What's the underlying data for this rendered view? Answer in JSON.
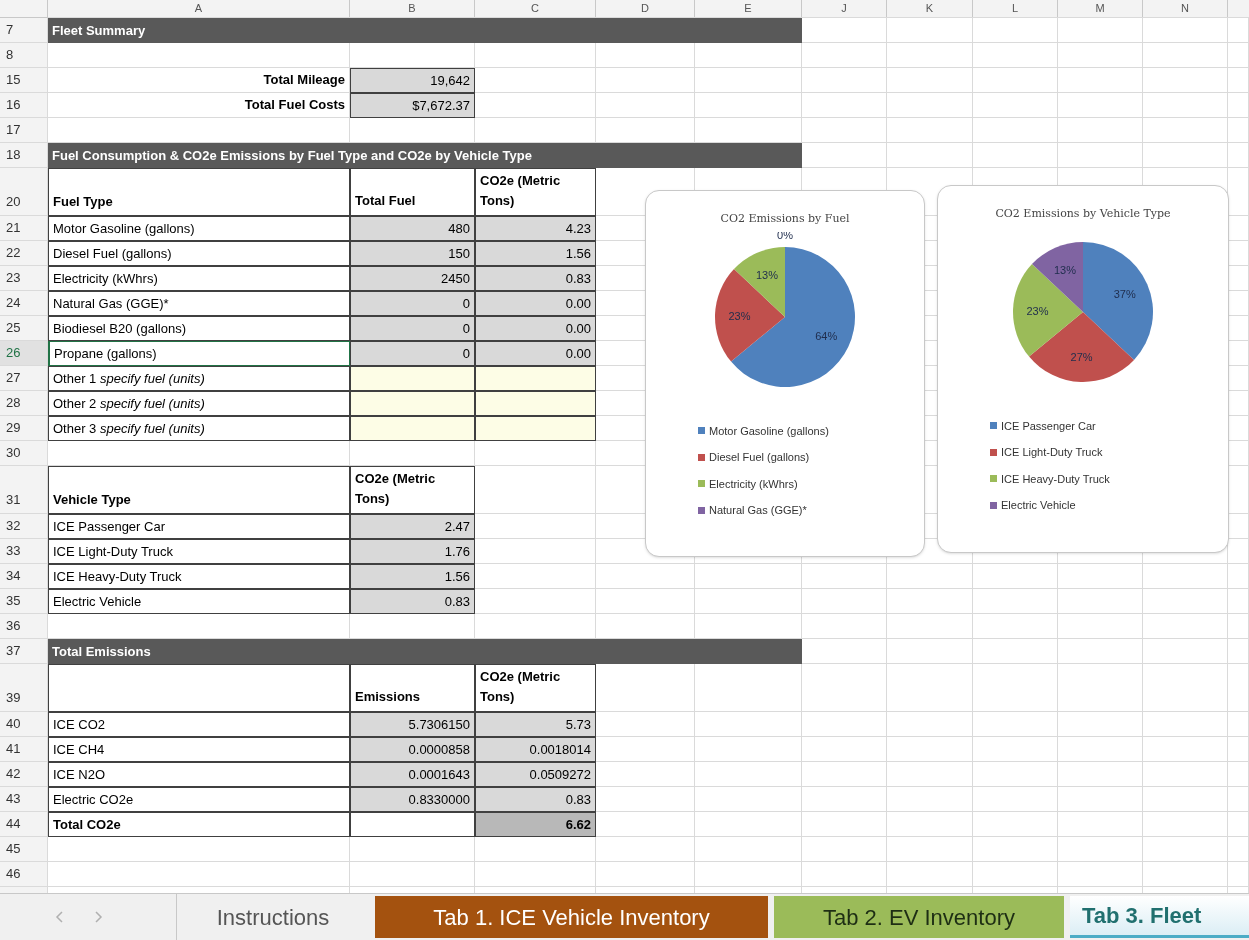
{
  "columns": [
    "A",
    "B",
    "C",
    "D",
    "E",
    "J",
    "K",
    "L",
    "M",
    "N"
  ],
  "rows": [
    {
      "number": "7",
      "kind": "section",
      "title": "Fleet Summary",
      "selected": false
    },
    {
      "number": "8",
      "kind": "blank",
      "selected": false
    },
    {
      "number": "15",
      "kind": "label_value",
      "label": "Total Mileage",
      "value": "19,642",
      "selected": false
    },
    {
      "number": "16",
      "kind": "label_value",
      "label": "Total Fuel Costs",
      "value": "$7,672.37",
      "selected": false
    },
    {
      "number": "17",
      "kind": "blank",
      "selected": false
    },
    {
      "number": "18",
      "kind": "section",
      "title": "Fuel Consumption & CO2e Emissions by Fuel Type and CO2e by Vehicle Type",
      "selected": false
    },
    {
      "number": "20",
      "kind": "header",
      "label": "Fuel Type",
      "headings": [
        "Total Fuel",
        "CO2e (Metric Tons)"
      ],
      "selected": false
    },
    {
      "number": "21",
      "kind": "data",
      "label": "Motor Gasoline (gallons)",
      "cells": [
        {
          "text": "480",
          "kind": "calc"
        },
        {
          "text": "4.23",
          "kind": "calc"
        }
      ],
      "selected": false
    },
    {
      "number": "22",
      "kind": "data",
      "label": "Diesel Fuel (gallons)",
      "cells": [
        {
          "text": "150",
          "kind": "calc"
        },
        {
          "text": "1.56",
          "kind": "calc"
        }
      ],
      "selected": false
    },
    {
      "number": "23",
      "kind": "data",
      "label": "Electricity (kWhrs)",
      "cells": [
        {
          "text": "2450",
          "kind": "calc"
        },
        {
          "text": "0.83",
          "kind": "calc"
        }
      ],
      "selected": false
    },
    {
      "number": "24",
      "kind": "data",
      "label": "Natural Gas (GGE)*",
      "cells": [
        {
          "text": "0",
          "kind": "calc"
        },
        {
          "text": "0.00",
          "kind": "calc"
        }
      ],
      "selected": false
    },
    {
      "number": "25",
      "kind": "data",
      "label": "Biodiesel B20 (gallons)",
      "cells": [
        {
          "text": "0",
          "kind": "calc"
        },
        {
          "text": "0.00",
          "kind": "calc"
        }
      ],
      "selected": false
    },
    {
      "number": "26",
      "kind": "data",
      "label": "Propane (gallons)",
      "cells": [
        {
          "text": "0",
          "kind": "calc"
        },
        {
          "text": "0.00",
          "kind": "calc"
        }
      ],
      "selected": true
    },
    {
      "number": "27",
      "kind": "data",
      "label": "Other 1 *specify fuel (units)*",
      "cells": [
        {
          "kind": "input"
        },
        {
          "kind": "input"
        }
      ],
      "selected": false
    },
    {
      "number": "28",
      "kind": "data",
      "label": "Other 2 *specify fuel (units)*",
      "cells": [
        {
          "kind": "input"
        },
        {
          "kind": "input"
        }
      ],
      "selected": false
    },
    {
      "number": "29",
      "kind": "data",
      "label": "Other 3 *specify fuel (units)*",
      "cells": [
        {
          "kind": "input"
        },
        {
          "kind": "input"
        }
      ],
      "selected": false
    },
    {
      "number": "30",
      "kind": "blank",
      "selected": false
    },
    {
      "number": "31",
      "kind": "header",
      "label": "Vehicle Type",
      "headings": [
        "CO2e (Metric Tons)"
      ],
      "selected": false
    },
    {
      "number": "32",
      "kind": "data",
      "label": "ICE Passenger Car",
      "cells": [
        {
          "text": "2.47",
          "kind": "calc"
        }
      ],
      "selected": false
    },
    {
      "number": "33",
      "kind": "data",
      "label": "ICE Light-Duty Truck",
      "cells": [
        {
          "text": "1.76",
          "kind": "calc"
        }
      ],
      "selected": false
    },
    {
      "number": "34",
      "kind": "data",
      "label": "ICE Heavy-Duty Truck",
      "cells": [
        {
          "text": "1.56",
          "kind": "calc"
        }
      ],
      "selected": false
    },
    {
      "number": "35",
      "kind": "data",
      "label": "Electric Vehicle",
      "cells": [
        {
          "text": "0.83",
          "kind": "calc"
        }
      ],
      "selected": false
    },
    {
      "number": "36",
      "kind": "blank",
      "selected": false
    },
    {
      "number": "37",
      "kind": "section",
      "title": "Total Emissions",
      "selected": false
    },
    {
      "number": "39",
      "kind": "header",
      "headings": [
        "Emissions",
        "CO2e (Metric Tons)"
      ],
      "selected": false
    },
    {
      "number": "40",
      "kind": "data",
      "label": "ICE CO2",
      "cells": [
        {
          "text": "5.7306150",
          "kind": "calc"
        },
        {
          "text": "5.73",
          "kind": "calc"
        }
      ],
      "selected": false
    },
    {
      "number": "41",
      "kind": "data",
      "label": "ICE CH4",
      "cells": [
        {
          "text": "0.0000858",
          "kind": "calc"
        },
        {
          "text": "0.0018014",
          "kind": "calc"
        }
      ],
      "selected": false
    },
    {
      "number": "42",
      "kind": "data",
      "label": "ICE N2O",
      "cells": [
        {
          "text": "0.0001643",
          "kind": "calc"
        },
        {
          "text": "0.0509272",
          "kind": "calc"
        }
      ],
      "selected": false
    },
    {
      "number": "43",
      "kind": "data",
      "label": "Electric CO2e",
      "cells": [
        {
          "text": "0.8330000",
          "kind": "calc"
        },
        {
          "text": "0.83",
          "kind": "calc"
        }
      ],
      "selected": false
    },
    {
      "number": "44",
      "kind": "total",
      "label": "Total CO2e",
      "cells": [
        {
          "kind": "blank"
        },
        {
          "text": "6.62",
          "kind": "total"
        }
      ],
      "selected": false
    },
    {
      "number": "45",
      "kind": "blank",
      "selected": false
    },
    {
      "number": "46",
      "kind": "blank",
      "selected": false
    }
  ],
  "charts": [
    {
      "chart_data": {
        "type": "pie",
        "title": "CO2 Emissions by Fuel",
        "legend": "bottom",
        "categories": [
          "Motor Gasoline (gallons)",
          "Diesel Fuel (gallons)",
          "Electricity (kWhrs)",
          "Natural Gas (GGE)*"
        ],
        "colors": [
          "#4f81bd",
          "#c0504d",
          "#9bbb59",
          "#8064a2"
        ],
        "values": [
          64,
          23,
          13,
          0
        ],
        "value_labels": [
          "64%",
          "23%",
          "13%",
          "0%"
        ]
      }
    },
    {
      "chart_data": {
        "type": "pie",
        "title": "CO2 Emissions by Vehicle Type",
        "legend": "bottom",
        "categories": [
          "ICE Passenger Car",
          "ICE Light-Duty Truck",
          "ICE Heavy-Duty Truck",
          "Electric Vehicle"
        ],
        "colors": [
          "#4f81bd",
          "#c0504d",
          "#9bbb59",
          "#8064a2"
        ],
        "values": [
          37,
          27,
          23,
          13
        ],
        "value_labels": [
          "37%",
          "27%",
          "23%",
          "13%"
        ]
      }
    }
  ],
  "sheet_tabs": [
    {
      "label": "Instructions",
      "selected": false
    },
    {
      "label": "Tab 1. ICE Vehicle Inventory",
      "selected": false,
      "color": "#a4520f"
    },
    {
      "label": "Tab 2. EV Inventory",
      "selected": false,
      "color": "#9bbb59"
    },
    {
      "label": "Tab 3. Fleet",
      "selected": true,
      "color": "#4bacc6"
    }
  ]
}
